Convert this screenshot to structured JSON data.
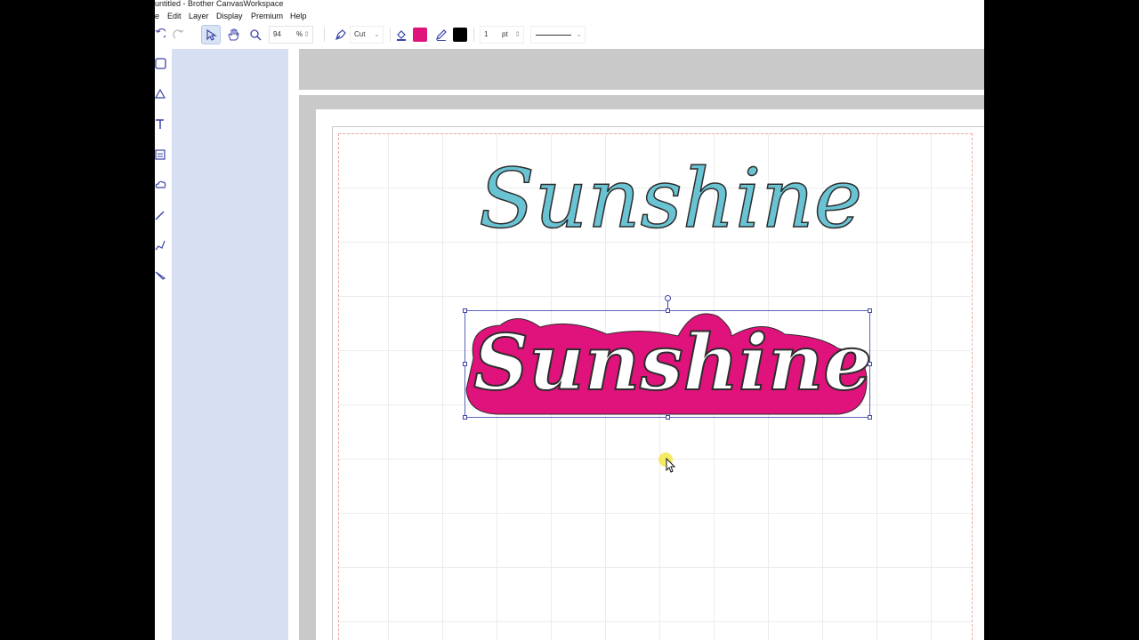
{
  "window": {
    "title": "untitled - Brother CanvasWorkspace"
  },
  "menu": {
    "items": [
      "e",
      "Edit",
      "Layer",
      "Display",
      "Premium",
      "Help"
    ]
  },
  "toolbar": {
    "zoom_value": "94",
    "zoom_unit": "%",
    "line_type": "Cut",
    "fill_color": "#e0127b",
    "line_color": "#000000",
    "line_width": "1",
    "line_width_unit": "pt"
  },
  "canvas": {
    "text_top": "Sunshine",
    "text_top_color": "#6ac3d3",
    "text_bottom": "Sunshine",
    "text_bottom_fill": "#e0127b"
  }
}
